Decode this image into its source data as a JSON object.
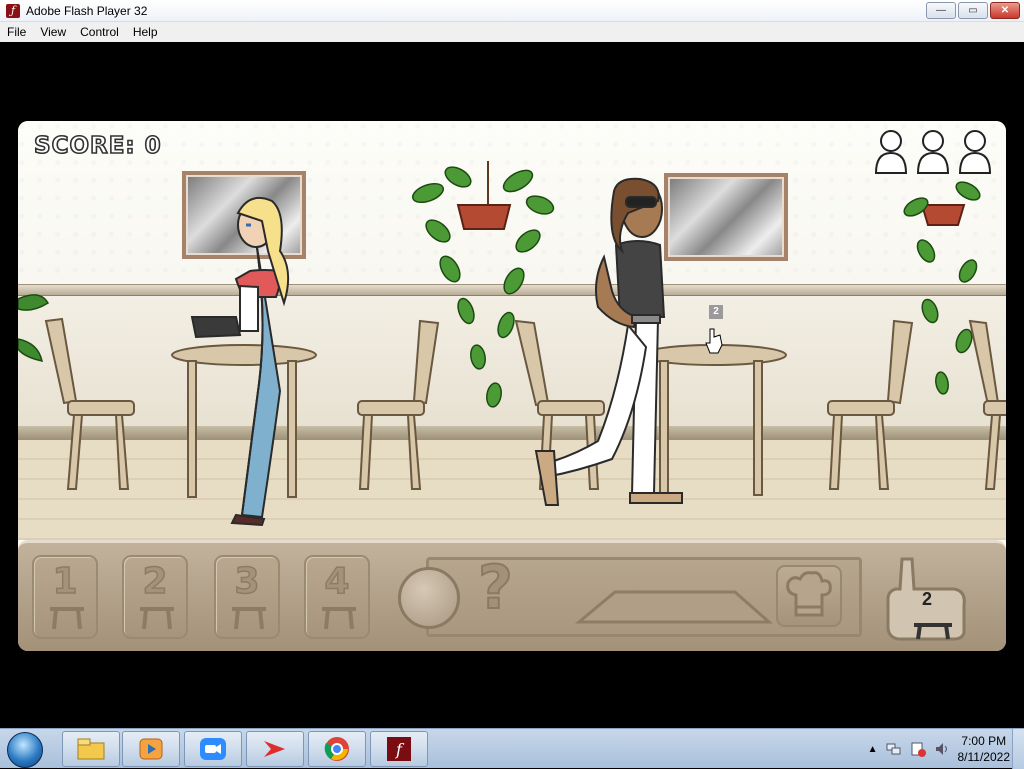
{
  "window": {
    "title": "Adobe Flash Player 32",
    "controls": {
      "minimize": "—",
      "maximize": "▭",
      "close": "✕"
    }
  },
  "menu": [
    "File",
    "View",
    "Control",
    "Help"
  ],
  "game": {
    "score_label": "SCORE: 0",
    "customers_waiting_icons": 3,
    "table_marker": "2",
    "panel": {
      "table_buttons": [
        "1",
        "2",
        "3",
        "4"
      ],
      "question_mark": "?",
      "hand_table_number": "2"
    }
  },
  "taskbar": {
    "apps": [
      "file-explorer-icon",
      "media-player-icon",
      "zoom-icon",
      "acrobat-icon",
      "chrome-icon",
      "flash-player-icon"
    ],
    "time": "7:00 PM",
    "date": "8/11/2022"
  }
}
